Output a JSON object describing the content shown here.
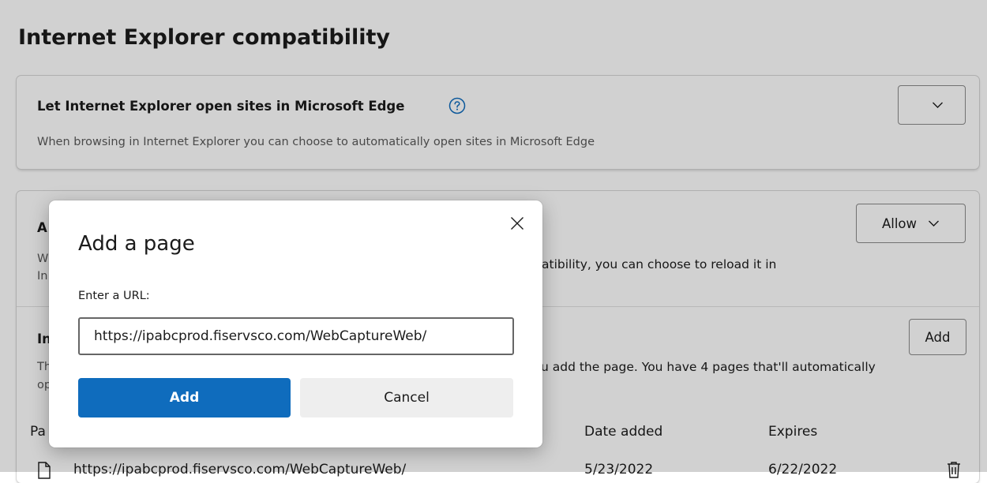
{
  "page": {
    "title": "Internet Explorer compatibility"
  },
  "ie_open_sites": {
    "title": "Let Internet Explorer open sites in Microsoft Edge",
    "description": "When browsing in Internet Explorer you can choose to automatically open sites in Microsoft Edge",
    "help_icon": "question-circle-icon",
    "dropdown_value": ""
  },
  "ie_mode_reload": {
    "title_fragment": "A",
    "desc_line1_left": "W",
    "desc_line1_right": "atibility, you can choose to reload it in",
    "desc_line2_left": "In",
    "dropdown_value": "Allow"
  },
  "ie_mode_pages": {
    "title_fragment": "In",
    "desc_line1_left": "Th",
    "desc_line1_right": "u add the page. You have 4 pages that'll automatically",
    "desc_line2_left": "op",
    "add_label": "Add",
    "columns": {
      "page_fragment": "Pa",
      "date_added": "Date added",
      "expires": "Expires"
    },
    "rows": [
      {
        "url": "https://ipabcprod.fiservsco.com/WebCaptureWeb/",
        "date_added": "5/23/2022",
        "expires": "6/22/2022"
      }
    ]
  },
  "dialog": {
    "title": "Add a page",
    "field_label": "Enter a URL:",
    "url_value": "https://ipabcprod.fiservsco.com/WebCaptureWeb/",
    "add_label": "Add",
    "cancel_label": "Cancel"
  },
  "colors": {
    "accent": "#0f6cbd",
    "help_icon": "#0f6cbd"
  }
}
